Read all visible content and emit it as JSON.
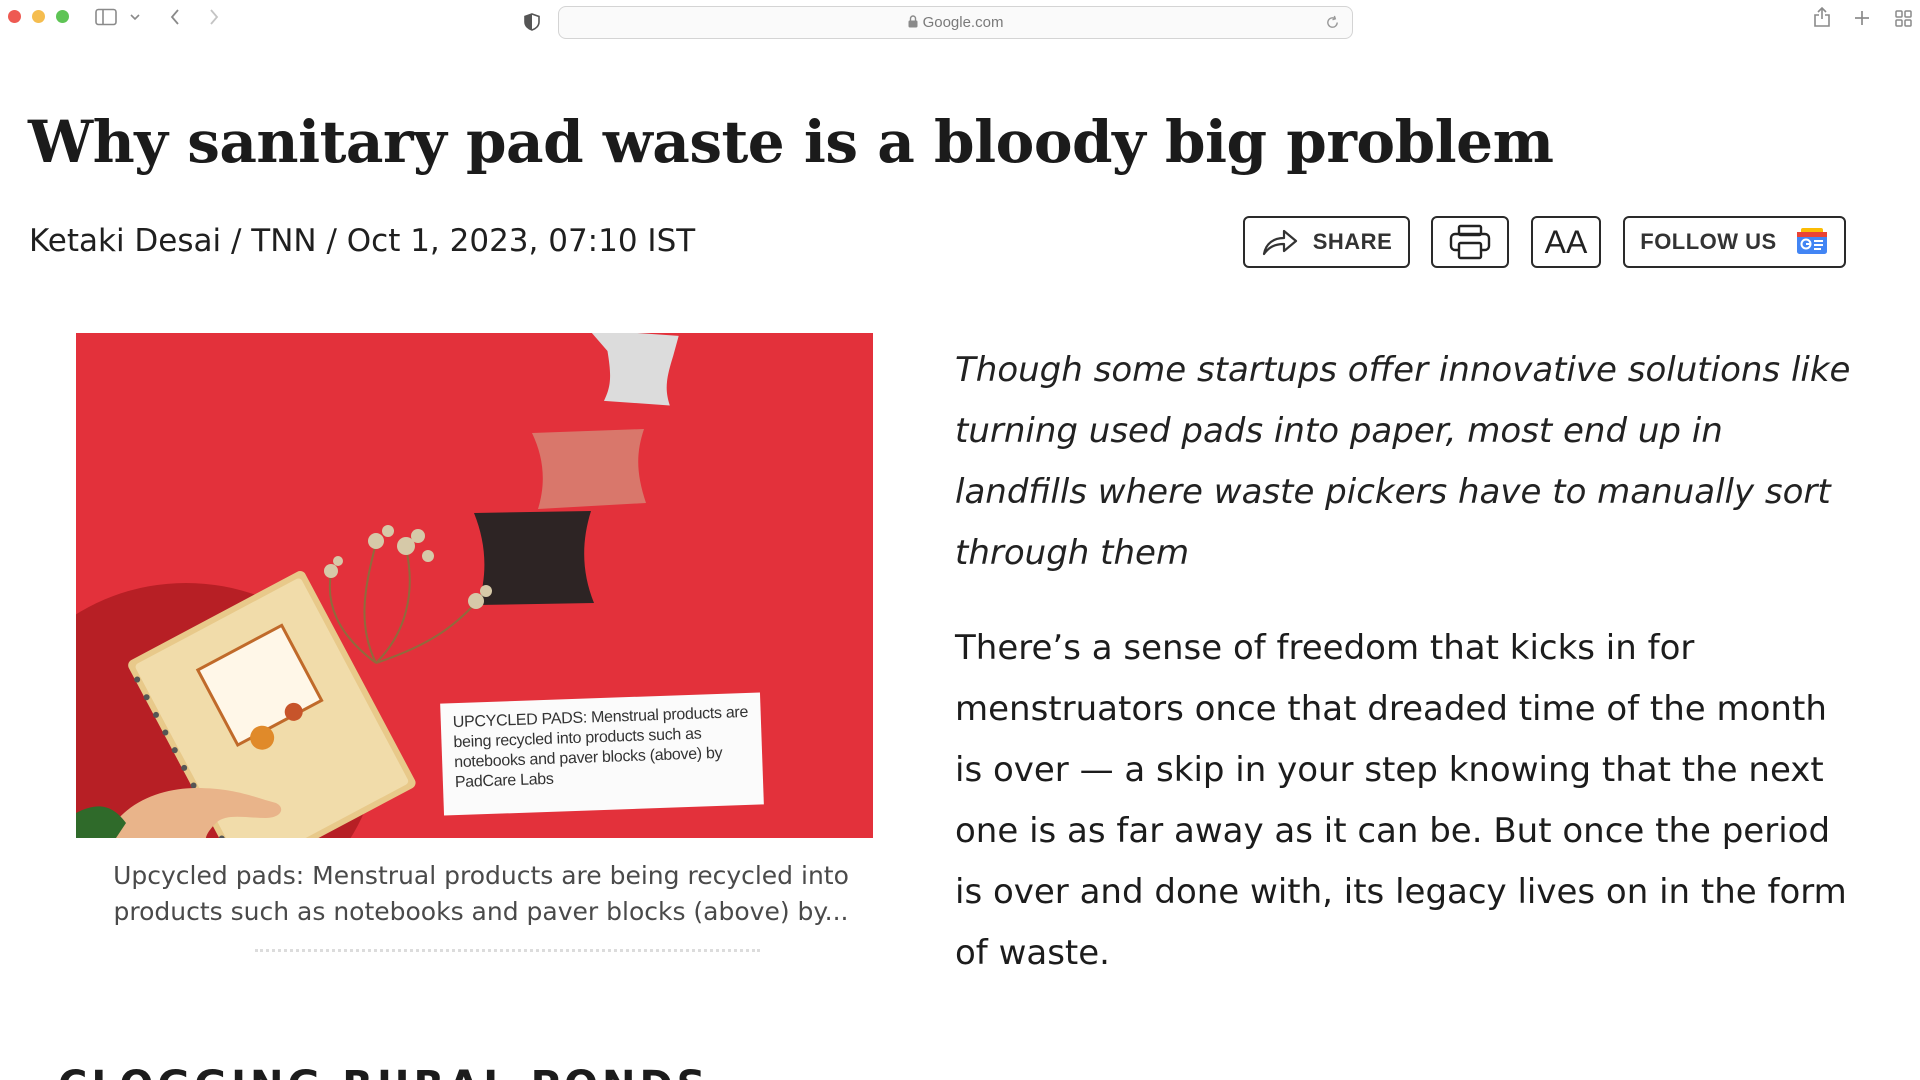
{
  "browser": {
    "url": "Google.com",
    "icons": [
      "sidebar-icon",
      "chevron-down-icon",
      "back-icon",
      "forward-icon",
      "shield-icon",
      "lock-icon",
      "reload-icon",
      "share-icon",
      "new-tab-icon",
      "tab-overview-icon"
    ]
  },
  "article": {
    "headline": "Why sanitary pad waste is a bloody big problem",
    "byline": "Ketaki Desai / TNN / Oct 1, 2023, 07:10 IST",
    "toolbar": {
      "share_label": "SHARE",
      "aa_label": "AA",
      "follow_label": "FOLLOW US"
    },
    "image": {
      "overlay_caption": "UPCYCLED PADS: Menstrual products are being recycled into products such as notebooks and paver blocks (above) by PadCare Labs",
      "caption": "Upcycled pads: Menstrual products are being recycled into products such as notebooks and paver blocks (above) by..."
    },
    "summary": "Though some startups offer innovative solutions like turning used pads into paper, most end up in landfills where waste pickers have to manually sort through them",
    "paragraph": "There’s a sense of freedom that kicks in for menstruators once that dreaded time of the month is over — a skip in your step knowing that the next one is as far away as it can be. But once the period is over and done with, its legacy lives on in the form of waste.",
    "next_section": "CLOGGING RURAL PONDS"
  },
  "colors": {
    "photo_background": "#e3313b",
    "traffic_red": "#ee5a52",
    "traffic_yellow": "#f5bd4f",
    "traffic_green": "#5ec455"
  }
}
